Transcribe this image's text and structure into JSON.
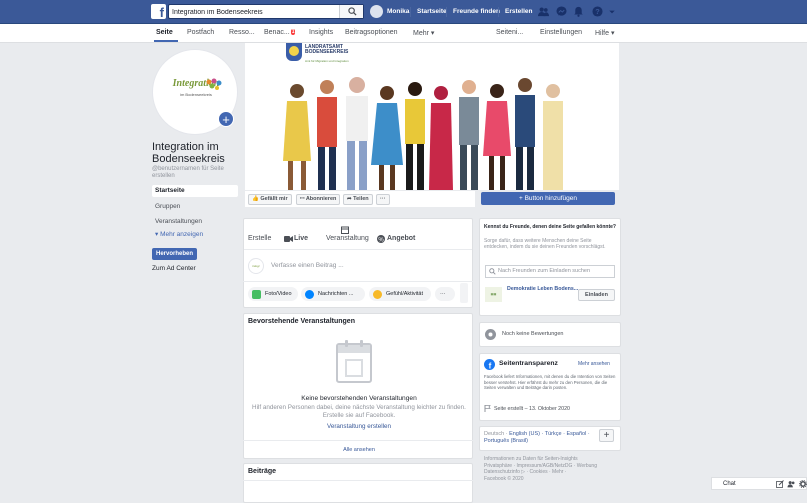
{
  "topbar": {
    "search_value": "Integration im Bodenseekreis",
    "user_name": "Monika",
    "nav": [
      "Startseite",
      "Freunde finden",
      "Erstellen"
    ]
  },
  "subnav": {
    "tabs": [
      "Seite",
      "Postfach",
      "Resso...",
      "Benac...",
      "Insights",
      "Beitragsoptionen",
      "Mehr ▾"
    ],
    "badge": "1",
    "right_tabs": [
      "Seiteni...",
      "Einstellungen",
      "Hilfe ▾"
    ]
  },
  "profile": {
    "logo_text": "Integration",
    "logo_sub": "im Bodenseekreis",
    "page_name": "Integration im Bodenseekreis",
    "username": "@benutzernamen für Seite erstellen"
  },
  "leftnav": {
    "items": [
      "Startseite",
      "Gruppen",
      "Veranstaltungen"
    ],
    "more": "▾ Mehr anzeigen",
    "promote": "Hervorheben",
    "adcenter": "Zum Ad Center"
  },
  "cover": {
    "org_line1": "LANDRATSAMT",
    "org_line2": "BODENSEEKREIS",
    "org_sub": "Amt für Migration und Integration"
  },
  "actions": {
    "like": "Gefällt mir",
    "subscribe": "Abonnieren",
    "share": "Teilen",
    "more": "···",
    "add_button": "+ Button hinzufügen"
  },
  "composer": {
    "tabs": [
      "Erstelle",
      "Live",
      "Veranstaltung",
      "Angebot"
    ],
    "placeholder": "Verfasse einen Beitrag ...",
    "pills": [
      "Foto/Video",
      "Nachrichten ...",
      "Gefühl/Aktivität",
      "···"
    ]
  },
  "events": {
    "title": "Bevorstehende Veranstaltungen",
    "empty_title": "Keine bevorstehenden Veranstaltungen",
    "empty_text": "Hilf anderen Personen dabei, deine nächste Veranstaltung leichter zu finden. Erstelle sie auf Facebook.",
    "create_link": "Veranstaltung erstellen",
    "all_link": "Alle ansehen"
  },
  "posts": {
    "title": "Beiträge"
  },
  "invite": {
    "title": "Kennst du Freunde, denen deine Seite gefallen könnte?",
    "text": "Sorge dafür, dass weitere Menschen deine Seite entdecken, indem du sie deinen Freunden vorschlägst.",
    "search_placeholder": "Nach Freunden zum Einladen suchen",
    "friend_name": "Demokratie Leben Bodens...",
    "invite_button": "Einladen"
  },
  "ratings": {
    "text": "Noch keine Bewertungen"
  },
  "transparency": {
    "title": "Seitentransparenz",
    "more": "Mehr ansehen",
    "text": "Facebook liefert Informationen, mit denen du die Intention von Seiten besser verstehst. Hier erfährst du mehr zu den Personen, die die Seiten verwalten und Beiträge darin posten.",
    "created": "Seite erstellt – 13. Oktober 2020"
  },
  "languages": {
    "current": "Deutsch ·",
    "links": [
      "English (US) ·",
      "Türkçe ·",
      "Español ·",
      "Português (Brasil)"
    ]
  },
  "footer": {
    "lines": [
      "Informationen zu Daten für Seiten-Insights",
      "Privatsphäre · Impressum/AGB/NetzDG · Werbung",
      "Datenschutzinfo ▷ · Cookies · Mehr ·",
      "Facebook © 2020"
    ]
  },
  "chat": {
    "label": "Chat"
  },
  "colors": {
    "brand": "#3b5998",
    "accent": "#4267b2",
    "background": "#e9ebee"
  }
}
